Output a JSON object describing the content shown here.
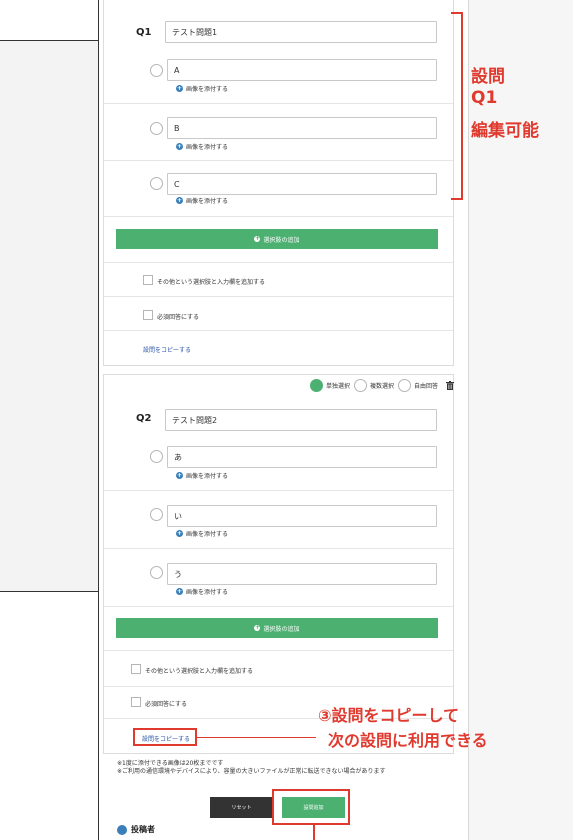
{
  "colors": {
    "accent_green": "#4cb071",
    "annotation_red": "#e03a2f",
    "link_blue": "#2a54a8",
    "icon_blue": "#3a7fb8",
    "dark_button": "#333333"
  },
  "q1": {
    "label": "Q1",
    "title_value": "テスト問題1",
    "choices": [
      {
        "value": "A",
        "attach": "画像を添付する"
      },
      {
        "value": "B",
        "attach": "画像を添付する"
      },
      {
        "value": "C",
        "attach": "画像を添付する"
      }
    ],
    "add_choice": "選択肢の追加",
    "other_option": "その他という選択肢と入力欄を追加する",
    "required": "必須回答にする",
    "copy": "設問をコピーする"
  },
  "q2": {
    "label": "Q2",
    "title_value": "テスト問題2",
    "types": {
      "single": "単独選択",
      "multiple": "複数選択",
      "free": "自由回答"
    },
    "choices": [
      {
        "value": "あ",
        "attach": "画像を添付する"
      },
      {
        "value": "い",
        "attach": "画像を添付する"
      },
      {
        "value": "う",
        "attach": "画像を添付する"
      }
    ],
    "add_choice": "選択肢の追加",
    "other_option": "その他という選択肢と入力欄を追加する",
    "required": "必須回答にする",
    "copy": "設問をコピーする"
  },
  "notes": {
    "line1": "※1度に添付できる画像は20枚までです",
    "line2": "※ご利用の通信環境やデバイスにより、容量の大きいファイルが正常に転送できない場合があります"
  },
  "buttons": {
    "reset": "リセット",
    "add_question": "設問追加"
  },
  "poster_label": "投稿者",
  "annotations": {
    "a1_line1": "設問",
    "a1_line2": "Q1",
    "a1_line3": "編集可能",
    "a2_line1": "③設問をコピーして",
    "a2_line2": "次の設問に利用できる"
  },
  "icons": {
    "attach": "plus-circle-icon",
    "add": "plus-circle-icon",
    "delete": "trash-icon",
    "poster": "user-icon"
  }
}
